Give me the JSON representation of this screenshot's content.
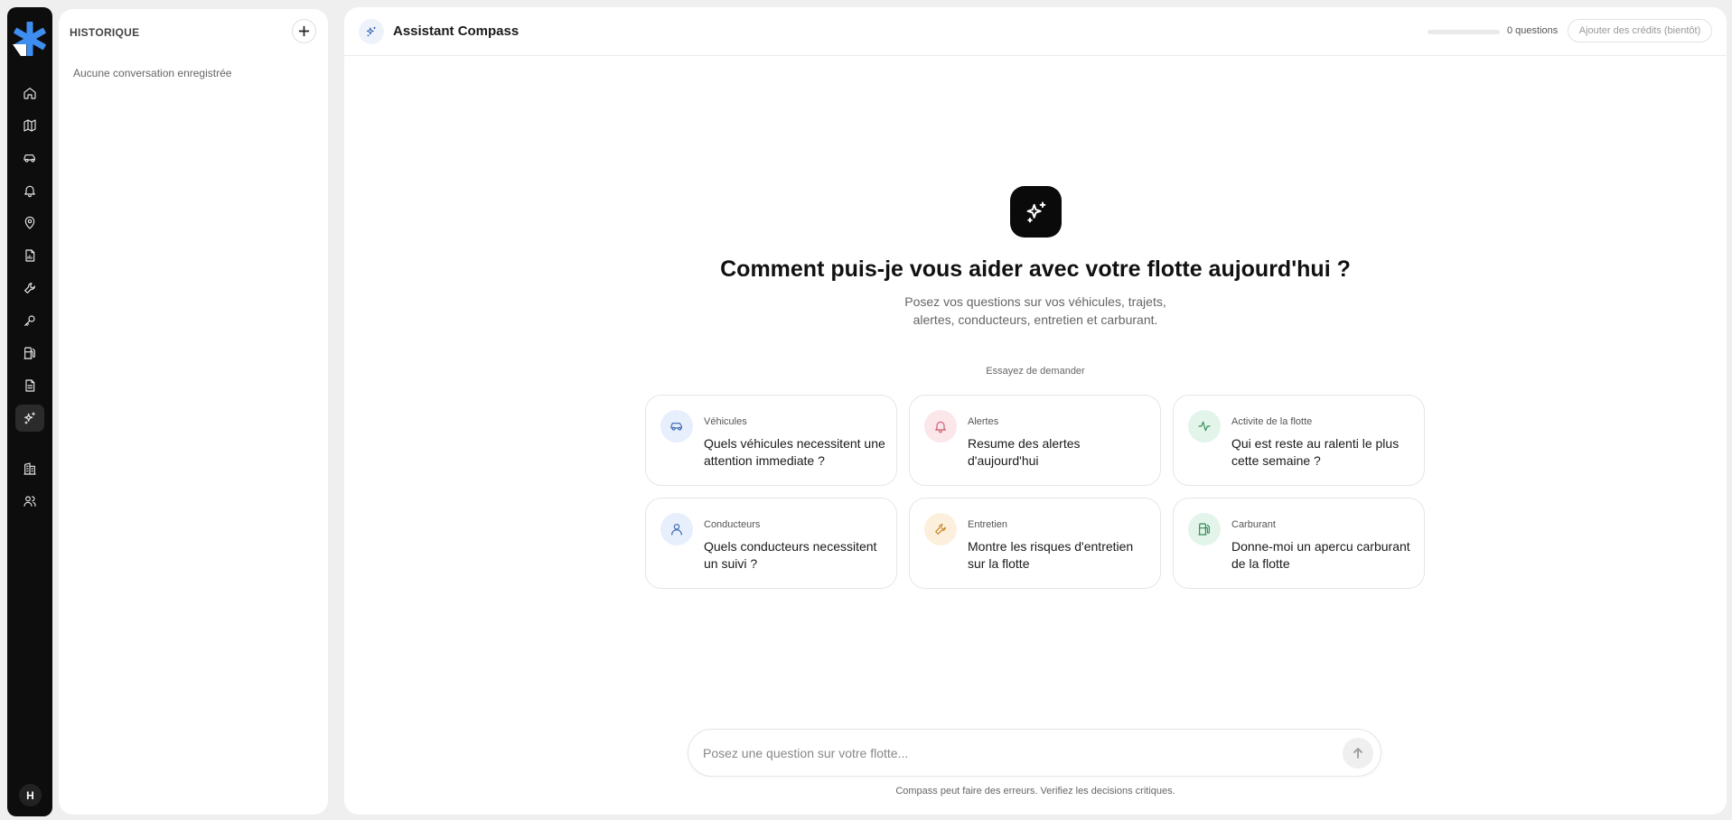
{
  "colors": {
    "rail_bg": "#0d0d0d",
    "accent_blue": "#3a66b0",
    "card_vehicules": "#e6effb",
    "card_alertes": "#fbe6e9",
    "card_activite": "#e3f4ea",
    "card_conducteurs": "#e6effb",
    "card_entretien": "#fcf0dd",
    "card_carburant": "#e3f4ea"
  },
  "rail": {
    "items": [
      {
        "icon": "home-icon"
      },
      {
        "icon": "map-icon"
      },
      {
        "icon": "car-icon"
      },
      {
        "icon": "bell-icon"
      },
      {
        "icon": "map-pin-icon"
      },
      {
        "icon": "report-icon"
      },
      {
        "icon": "wrench-icon"
      },
      {
        "icon": "key-icon"
      },
      {
        "icon": "fuel-icon"
      },
      {
        "icon": "document-icon"
      },
      {
        "icon": "sparkles-icon",
        "active": true
      },
      {
        "icon": "building-icon"
      },
      {
        "icon": "users-icon"
      }
    ],
    "avatar_initial": "H"
  },
  "history": {
    "title": "HISTORIQUE",
    "empty_text": "Aucune conversation enregistrée"
  },
  "topbar": {
    "title": "Assistant Compass",
    "questions_count": "0 questions",
    "quota_used_fraction": 0,
    "credits_button": "Ajouter des crédits (bientôt)"
  },
  "hero": {
    "title": "Comment puis-je vous aider avec votre flotte aujourd'hui ?",
    "subtitle_line1": "Posez vos questions sur vos véhicules, trajets,",
    "subtitle_line2": "alertes, conducteurs, entretien et carburant.",
    "try_label": "Essayez de demander"
  },
  "suggestions": [
    {
      "category": "Véhicules",
      "question": "Quels véhicules necessitent une attention immediate ?",
      "icon": "car-icon"
    },
    {
      "category": "Alertes",
      "question": "Resume des alertes d'aujourd'hui",
      "icon": "bell-icon"
    },
    {
      "category": "Activite de la flotte",
      "question": "Qui est reste au ralenti le plus cette semaine ?",
      "icon": "activity-icon"
    },
    {
      "category": "Conducteurs",
      "question": "Quels conducteurs necessitent un suivi ?",
      "icon": "user-icon"
    },
    {
      "category": "Entretien",
      "question": "Montre les risques d'entretien sur la flotte",
      "icon": "wrench-icon"
    },
    {
      "category": "Carburant",
      "question": "Donne-moi un apercu carburant de la flotte",
      "icon": "fuel-icon"
    }
  ],
  "composer": {
    "placeholder": "Posez une question sur votre flotte...",
    "value": ""
  },
  "disclaimer": "Compass peut faire des erreurs. Verifiez les decisions critiques."
}
